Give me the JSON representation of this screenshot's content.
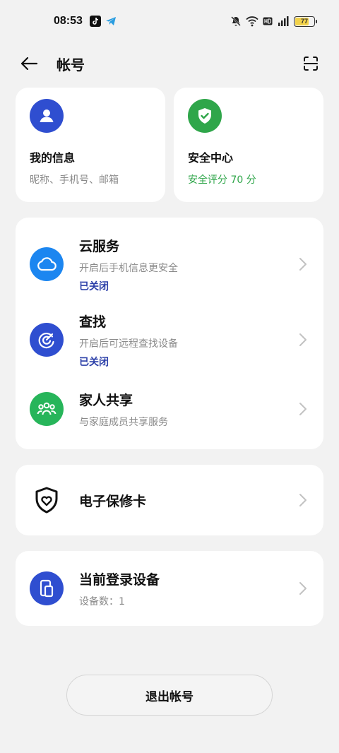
{
  "status": {
    "time": "08:53",
    "battery": "77",
    "battery_level": 0.77
  },
  "appbar": {
    "title": "帐号"
  },
  "my_info": {
    "title": "我的信息",
    "subtitle": "昵称、手机号、邮箱"
  },
  "security": {
    "title": "安全中心",
    "subtitle": "安全评分 70 分"
  },
  "services": [
    {
      "title": "云服务",
      "subtitle": "开启后手机信息更安全",
      "status": "已关闭"
    },
    {
      "title": "查找",
      "subtitle": "开启后可远程查找设备",
      "status": "已关闭"
    },
    {
      "title": "家人共享",
      "subtitle": "与家庭成员共享服务"
    }
  ],
  "warranty": {
    "title": "电子保修卡"
  },
  "devices": {
    "title": "当前登录设备",
    "subtitle": "设备数：1"
  },
  "logout": {
    "label": "退出帐号"
  },
  "colors": {
    "blue": "#2f4ed0",
    "green": "#2fa64a",
    "cloud_blue": "#1c86f0",
    "family_green": "#27b55a"
  }
}
